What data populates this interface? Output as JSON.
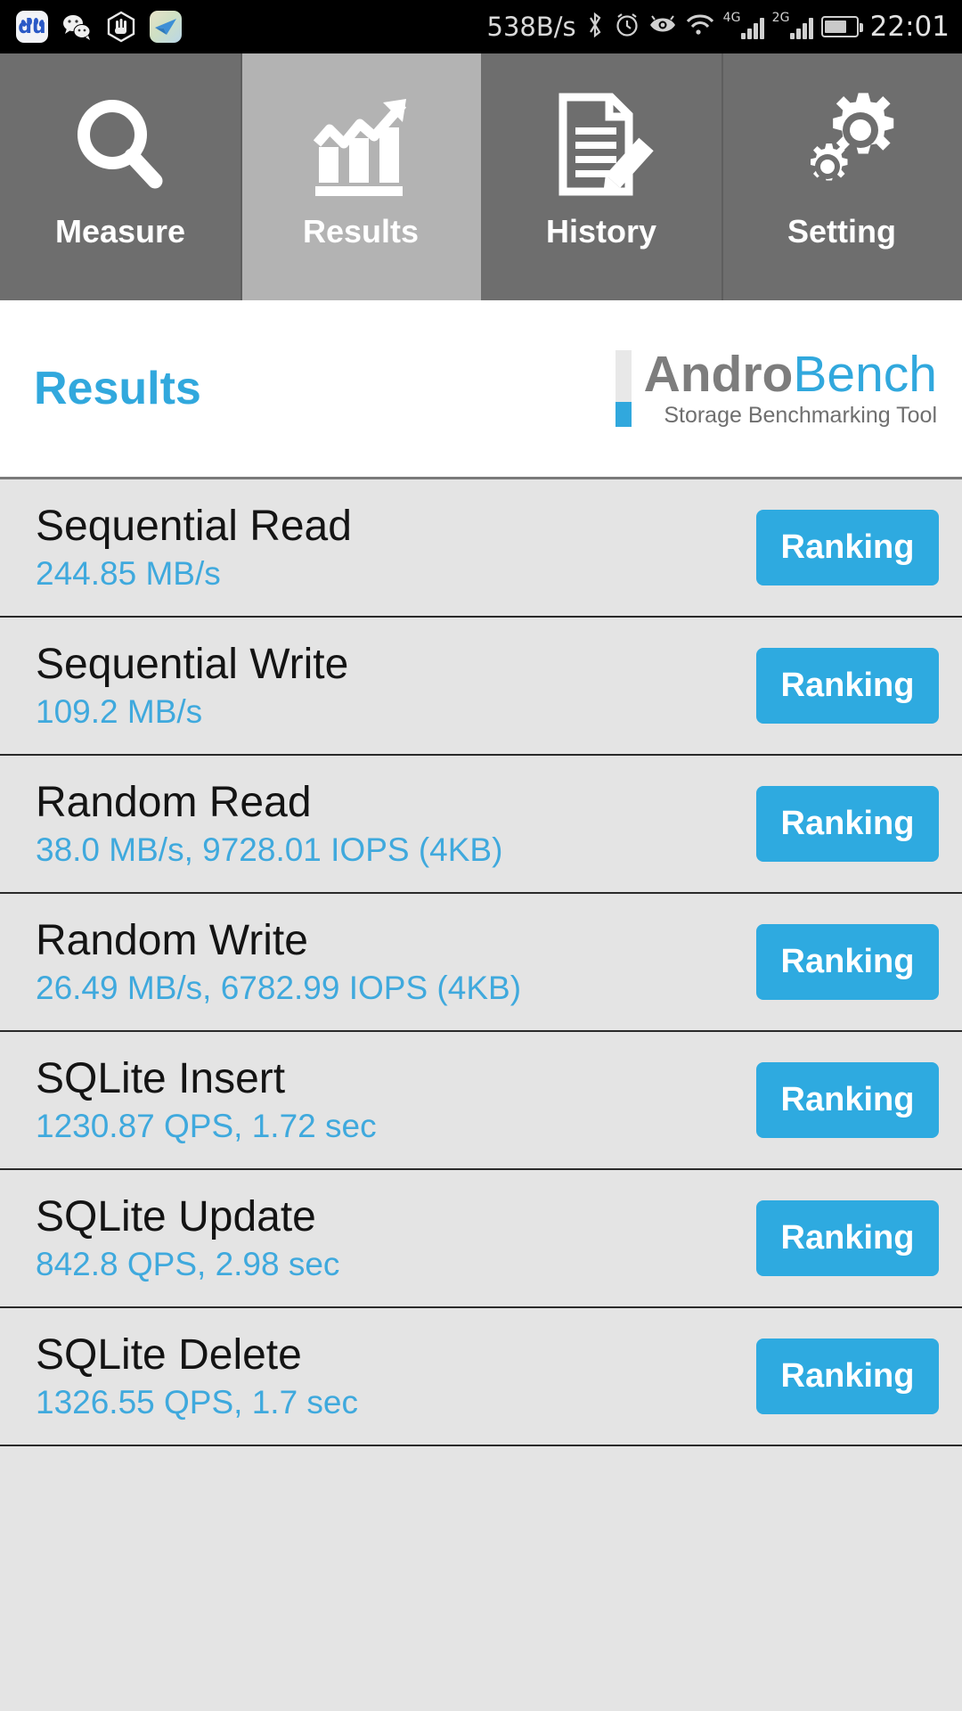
{
  "status_bar": {
    "app_icons": [
      {
        "name": "baidu-icon",
        "label": "du"
      },
      {
        "name": "wechat-icon",
        "label": ""
      },
      {
        "name": "blocker-hand-icon",
        "label": ""
      },
      {
        "name": "maps-icon",
        "label": ""
      }
    ],
    "network_speed": "538B/s",
    "icons": [
      {
        "name": "bluetooth-icon"
      },
      {
        "name": "alarm-clock-icon"
      },
      {
        "name": "eye-care-icon"
      },
      {
        "name": "wifi-icon"
      }
    ],
    "signal_1_label": "4G",
    "signal_2_label": "2G",
    "battery_name": "battery-icon",
    "time": "22:01"
  },
  "tabs": [
    {
      "label": "Measure",
      "icon": "magnifier-icon",
      "active": false
    },
    {
      "label": "Results",
      "icon": "bar-chart-arrow-icon",
      "active": true
    },
    {
      "label": "History",
      "icon": "document-pencil-icon",
      "active": false
    },
    {
      "label": "Setting",
      "icon": "gears-icon",
      "active": false
    }
  ],
  "header": {
    "title": "Results",
    "brand_part1": "Andro",
    "brand_part2": "Bench",
    "brand_tagline": "Storage Benchmarking Tool"
  },
  "colors": {
    "accent_blue": "#2eaae0",
    "value_blue": "#3fa9dd",
    "title_blue": "#31a8dd",
    "list_background": "#e4e4e4",
    "tab_background": "#6e6e6e",
    "tab_active_background": "#b3b3b3"
  },
  "results": [
    {
      "title": "Sequential Read",
      "value": "244.85 MB/s",
      "button": "Ranking"
    },
    {
      "title": "Sequential Write",
      "value": "109.2 MB/s",
      "button": "Ranking"
    },
    {
      "title": "Random Read",
      "value": "38.0 MB/s, 9728.01 IOPS (4KB)",
      "button": "Ranking"
    },
    {
      "title": "Random Write",
      "value": "26.49 MB/s, 6782.99 IOPS (4KB)",
      "button": "Ranking"
    },
    {
      "title": "SQLite Insert",
      "value": "1230.87 QPS, 1.72 sec",
      "button": "Ranking"
    },
    {
      "title": "SQLite Update",
      "value": "842.8 QPS, 2.98 sec",
      "button": "Ranking"
    },
    {
      "title": "SQLite Delete",
      "value": "1326.55 QPS, 1.7 sec",
      "button": "Ranking"
    }
  ]
}
